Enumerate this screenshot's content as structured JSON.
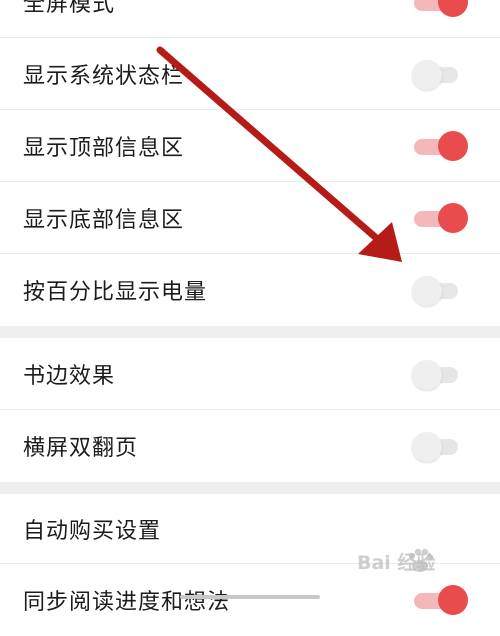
{
  "settings": {
    "items": [
      {
        "label": "全屏模式",
        "on": true
      },
      {
        "label": "显示系统状态栏",
        "on": false
      },
      {
        "label": "显示顶部信息区",
        "on": true
      },
      {
        "label": "显示底部信息区",
        "on": true
      },
      {
        "label": "按百分比显示电量",
        "on": false
      },
      {
        "label": "书边效果",
        "on": false
      },
      {
        "label": "横屏双翻页",
        "on": false
      },
      {
        "label": "自动购买设置"
      },
      {
        "label": "同步阅读进度和想法",
        "on": true
      }
    ]
  },
  "watermark": {
    "text": "Bai 经验"
  },
  "icons": {
    "arrow": "arrow-icon",
    "paw": "paw-icon"
  },
  "colors": {
    "accent": "#e84c4c",
    "toggle_off": "#efefef",
    "arrow": "#b51c17"
  }
}
